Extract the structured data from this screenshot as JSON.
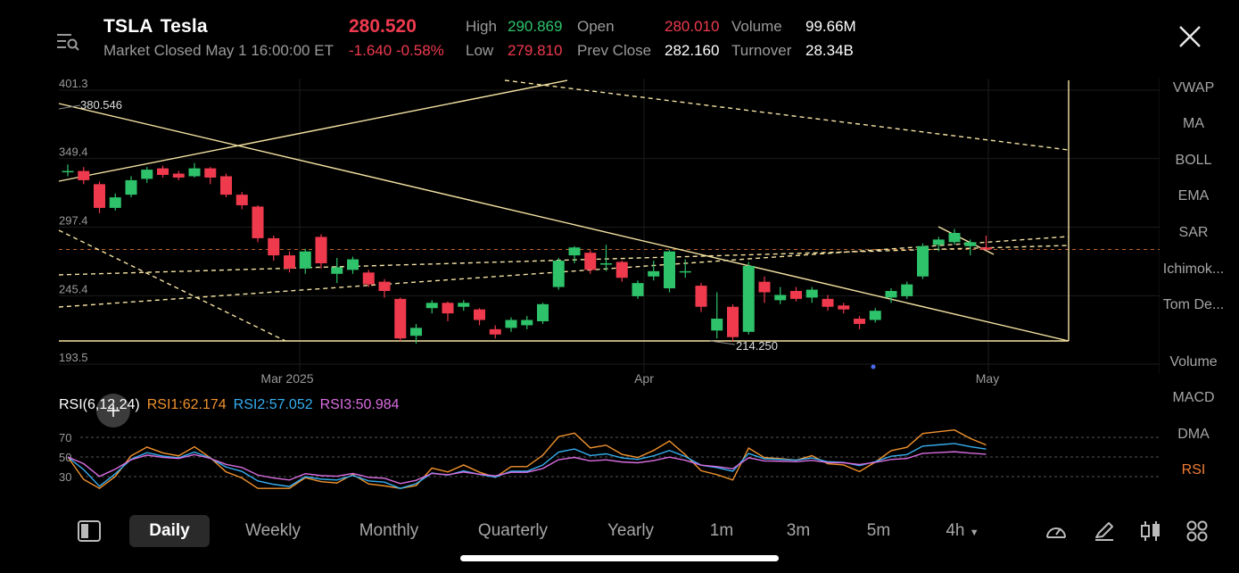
{
  "header": {
    "symbol": "TSLA",
    "company": "Tesla",
    "status": "Market Closed May 1 16:00:00 ET",
    "price": "280.520",
    "change": "-1.640",
    "change_pct": "-0.58%",
    "stats": {
      "high_label": "High",
      "high": "290.869",
      "low_label": "Low",
      "low": "279.810",
      "open_label": "Open",
      "open": "280.010",
      "prev_close_label": "Prev Close",
      "prev_close": "282.160",
      "volume_label": "Volume",
      "volume": "99.66M",
      "turnover_label": "Turnover",
      "turnover": "28.34B"
    }
  },
  "side_indicators": {
    "main": [
      "VWAP",
      "MA",
      "BOLL",
      "EMA",
      "SAR",
      "Ichimok...",
      "Tom De..."
    ],
    "sub": [
      "Volume",
      "MACD",
      "DMA",
      "RSI"
    ],
    "active": "RSI"
  },
  "chart_data": {
    "type": "candlestick",
    "y_ticks": [
      "401.3",
      "349.4",
      "297.4",
      "245.4",
      "193.5"
    ],
    "x_ticks": [
      "Mar 2025",
      "Apr",
      "May"
    ],
    "annotations": {
      "high_marker": "380.546",
      "low_marker": "214.250"
    },
    "candles": [
      {
        "o": 340,
        "c": 340,
        "h": 345,
        "l": 336
      },
      {
        "o": 340,
        "c": 333,
        "h": 343,
        "l": 330
      },
      {
        "o": 330,
        "c": 312,
        "h": 332,
        "l": 308
      },
      {
        "o": 312,
        "c": 320,
        "h": 323,
        "l": 310
      },
      {
        "o": 322,
        "c": 333,
        "h": 336,
        "l": 320
      },
      {
        "o": 334,
        "c": 341,
        "h": 343,
        "l": 331
      },
      {
        "o": 342,
        "c": 337,
        "h": 344,
        "l": 335
      },
      {
        "o": 338,
        "c": 335,
        "h": 340,
        "l": 333
      },
      {
        "o": 336,
        "c": 342,
        "h": 346,
        "l": 335
      },
      {
        "o": 342,
        "c": 335,
        "h": 343,
        "l": 330
      },
      {
        "o": 336,
        "c": 322,
        "h": 338,
        "l": 320
      },
      {
        "o": 322,
        "c": 314,
        "h": 324,
        "l": 311
      },
      {
        "o": 313,
        "c": 289,
        "h": 314,
        "l": 286
      },
      {
        "o": 289,
        "c": 276,
        "h": 291,
        "l": 272
      },
      {
        "o": 276,
        "c": 266,
        "h": 279,
        "l": 263
      },
      {
        "o": 266,
        "c": 279,
        "h": 281,
        "l": 262
      },
      {
        "o": 290,
        "c": 270,
        "h": 292,
        "l": 266
      },
      {
        "o": 262,
        "c": 267,
        "h": 274,
        "l": 255
      },
      {
        "o": 265,
        "c": 273,
        "h": 275,
        "l": 262
      },
      {
        "o": 263,
        "c": 254,
        "h": 265,
        "l": 252
      },
      {
        "o": 256,
        "c": 249,
        "h": 258,
        "l": 244
      },
      {
        "o": 243,
        "c": 213,
        "h": 244,
        "l": 211
      },
      {
        "o": 215,
        "c": 221,
        "h": 224,
        "l": 209
      },
      {
        "o": 236,
        "c": 240,
        "h": 242,
        "l": 232
      },
      {
        "o": 240,
        "c": 232,
        "h": 241,
        "l": 226
      },
      {
        "o": 237,
        "c": 240,
        "h": 242,
        "l": 234
      },
      {
        "o": 235,
        "c": 227,
        "h": 236,
        "l": 223
      },
      {
        "o": 220,
        "c": 216,
        "h": 223,
        "l": 213
      },
      {
        "o": 221,
        "c": 227,
        "h": 229,
        "l": 218
      },
      {
        "o": 223,
        "c": 227,
        "h": 230,
        "l": 220
      },
      {
        "o": 226,
        "c": 239,
        "h": 240,
        "l": 224
      },
      {
        "o": 252,
        "c": 272,
        "h": 274,
        "l": 250
      },
      {
        "o": 276,
        "c": 282,
        "h": 283,
        "l": 270
      },
      {
        "o": 278,
        "c": 265,
        "h": 280,
        "l": 262
      },
      {
        "o": 269,
        "c": 270,
        "h": 284,
        "l": 264
      },
      {
        "o": 271,
        "c": 259,
        "h": 272,
        "l": 256
      },
      {
        "o": 245,
        "c": 255,
        "h": 257,
        "l": 243
      },
      {
        "o": 260,
        "c": 264,
        "h": 272,
        "l": 257
      },
      {
        "o": 251,
        "c": 279,
        "h": 280,
        "l": 248
      },
      {
        "o": 263,
        "c": 264,
        "h": 273,
        "l": 259
      },
      {
        "o": 253,
        "c": 237,
        "h": 255,
        "l": 233
      },
      {
        "o": 219,
        "c": 228,
        "h": 248,
        "l": 213
      },
      {
        "o": 237,
        "c": 214,
        "h": 239,
        "l": 211
      },
      {
        "o": 218,
        "c": 268,
        "h": 271,
        "l": 216
      },
      {
        "o": 256,
        "c": 248,
        "h": 260,
        "l": 240
      },
      {
        "o": 242,
        "c": 246,
        "h": 252,
        "l": 239
      },
      {
        "o": 249,
        "c": 243,
        "h": 252,
        "l": 241
      },
      {
        "o": 244,
        "c": 250,
        "h": 252,
        "l": 240
      },
      {
        "o": 243,
        "c": 237,
        "h": 246,
        "l": 234
      },
      {
        "o": 238,
        "c": 235,
        "h": 240,
        "l": 232
      },
      {
        "o": 228,
        "c": 224,
        "h": 230,
        "l": 220
      },
      {
        "o": 227,
        "c": 234,
        "h": 236,
        "l": 225
      },
      {
        "o": 244,
        "c": 249,
        "h": 251,
        "l": 240
      },
      {
        "o": 245,
        "c": 254,
        "h": 256,
        "l": 243
      },
      {
        "o": 260,
        "c": 283,
        "h": 285,
        "l": 258
      },
      {
        "o": 284,
        "c": 288,
        "h": 290,
        "l": 279
      },
      {
        "o": 286,
        "c": 293,
        "h": 296,
        "l": 284
      },
      {
        "o": 283,
        "c": 286,
        "h": 288,
        "l": 276
      },
      {
        "o": 282,
        "c": 280.5,
        "h": 291,
        "l": 279.8
      }
    ],
    "rsi": {
      "label": "RSI(6,12,24)",
      "rsi1_label": "RSI1:62.174",
      "rsi2_label": "RSI2:57.052",
      "rsi3_label": "RSI3:50.984",
      "levels": [
        "70",
        "50",
        "30"
      ]
    }
  },
  "periods": [
    "Daily",
    "Weekly",
    "Monthly",
    "Quarterly",
    "Yearly",
    "1m",
    "3m",
    "5m",
    "4h"
  ],
  "active_period": "Daily",
  "colors": {
    "up": "#2ec26a",
    "down": "#ef3a4e",
    "trend": "#f5e3a3",
    "rsi1": "#f0922e",
    "rsi2": "#35aef0",
    "rsi3": "#d96de0",
    "active": "#f07d36"
  }
}
